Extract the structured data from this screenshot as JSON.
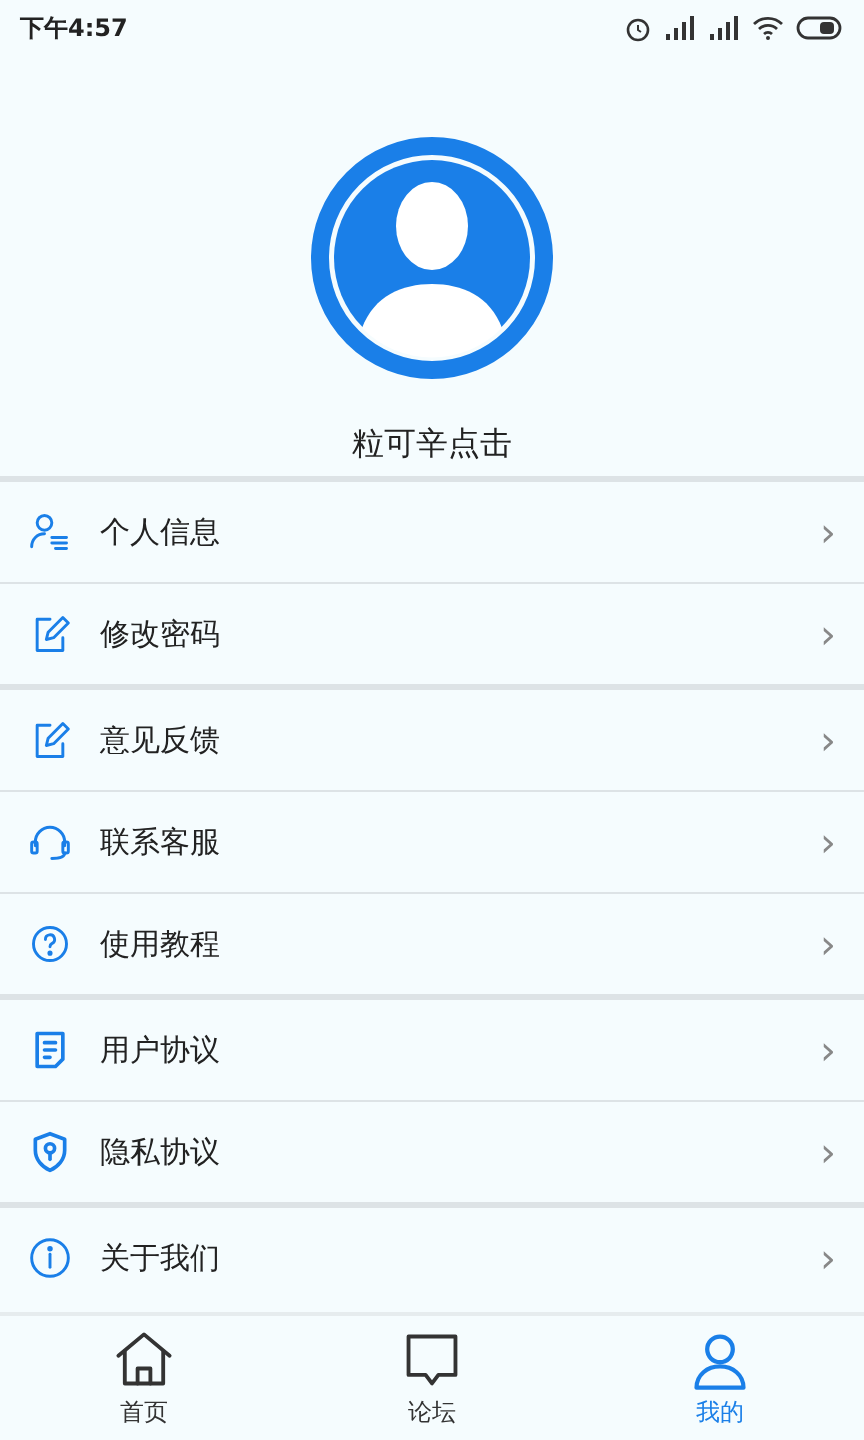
{
  "status_bar": {
    "time": "下午4:57"
  },
  "profile": {
    "name": "粒可辛点击"
  },
  "menu_sections": [
    {
      "items": [
        {
          "kind": "profile",
          "label": "个人信息",
          "chevron": "›"
        },
        {
          "kind": "edit",
          "label": "修改密码",
          "chevron": "›"
        }
      ]
    },
    {
      "items": [
        {
          "kind": "edit",
          "label": "意见反馈",
          "chevron": "›"
        },
        {
          "kind": "headset",
          "label": "联系客服",
          "chevron": "›"
        },
        {
          "kind": "help",
          "label": "使用教程",
          "chevron": "›"
        }
      ]
    },
    {
      "items": [
        {
          "kind": "document",
          "label": "用户协议",
          "chevron": "›"
        },
        {
          "kind": "shield",
          "label": "隐私协议",
          "chevron": "›"
        }
      ]
    },
    {
      "items": [
        {
          "kind": "info",
          "label": "关于我们",
          "chevron": "›"
        }
      ]
    }
  ],
  "tab_bar": [
    {
      "kind": "home",
      "label": "首页",
      "selected": false
    },
    {
      "kind": "forum",
      "label": "论坛",
      "selected": false
    },
    {
      "kind": "me",
      "label": "我的",
      "selected": true
    }
  ]
}
